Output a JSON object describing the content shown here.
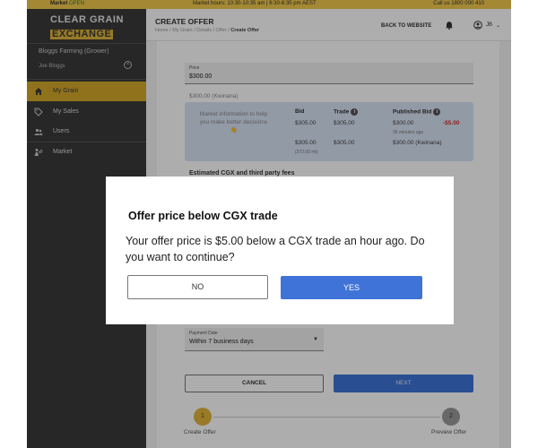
{
  "topbar": {
    "market_label": "Market",
    "market_status": "OPEN",
    "hours": "Market hours: 10:30-10:35 am | 6:30-6:35 pm AEST",
    "call": "Call us 1800 000 410"
  },
  "sidebar": {
    "logo_line1": "CLEAR GRAIN",
    "logo_line2": "EXCHANGE",
    "org": "Bloggs Farming (Grower)",
    "user": "Joe Bloggs",
    "items": [
      {
        "label": "My Grain",
        "icon": "home-icon",
        "active": true
      },
      {
        "label": "My Sales",
        "icon": "tag-icon",
        "active": false
      },
      {
        "label": "Users",
        "icon": "users-icon",
        "active": false
      },
      {
        "label": "Market",
        "icon": "market-icon",
        "active": false
      }
    ]
  },
  "header": {
    "title": "CREATE OFFER",
    "breadcrumb": "Home / My Grain / Details / Offer / ",
    "breadcrumb_current": "Create Offer",
    "back_link": "BACK TO WEBSITE",
    "initials": "JB",
    "chevron": "⌄"
  },
  "form": {
    "price_label": "Price",
    "price_value": "$300.00",
    "price_hint": "$300.00 (Kwinana)",
    "market_info": "Market information to help you make better decisions 👋",
    "bid_header": "Bid",
    "bid_value": "$305.00",
    "bid_value2": "$305.00",
    "bid_sub": "(372.00 mt)",
    "trade_header": "Trade",
    "trade_value": "$305.00",
    "trade_value2": "$305.00",
    "published_header": "Published Bid",
    "published_value": "$300.00",
    "published_diff": "-$5.00",
    "published_ago": "36 minutes ago",
    "published_loc": "$300.00 (Kwinana)",
    "fees_header": "Estimated CGX and third party fees",
    "payment_label": "Payment Date",
    "payment_value": "Within 7 business days",
    "cancel_label": "CANCEL",
    "next_label": "NEXT"
  },
  "steps": [
    {
      "number": "1",
      "label": "Create Offer"
    },
    {
      "number": "2",
      "label": "Preview Offer"
    }
  ],
  "dialog": {
    "title": "Offer price below CGX trade",
    "message": "Your offer price is $5.00 below a CGX trade an hour ago. Do you want to continue?",
    "no_label": "NO",
    "yes_label": "YES"
  },
  "colors": {
    "brand_gold": "#e0b43a",
    "primary_blue": "#3f73d8",
    "sidebar_dark": "#3a3a3a",
    "negative_red": "#d32f2f"
  }
}
